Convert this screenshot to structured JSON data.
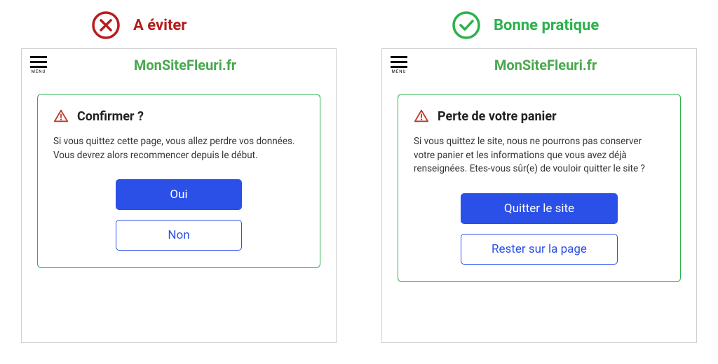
{
  "headers": {
    "bad_label": "A éviter",
    "good_label": "Bonne pratique"
  },
  "site": {
    "menu_label": "MENU",
    "title": "MonSiteFleuri.fr"
  },
  "bad_dialog": {
    "title": "Confirmer ?",
    "body": "Si vous quittez cette page, vous allez perdre vos données. Vous devrez alors recommencer depuis le début.",
    "primary_button": "Oui",
    "secondary_button": "Non"
  },
  "good_dialog": {
    "title": "Perte de votre panier",
    "body": "Si vous quittez le site, nous ne pourrons pas conserver votre panier et les informations que vous avez déjà renseignées. Etes-vous sûr(e) de vouloir quitter le site ?",
    "primary_button": "Quitter le site",
    "secondary_button": "Rester sur la page"
  }
}
